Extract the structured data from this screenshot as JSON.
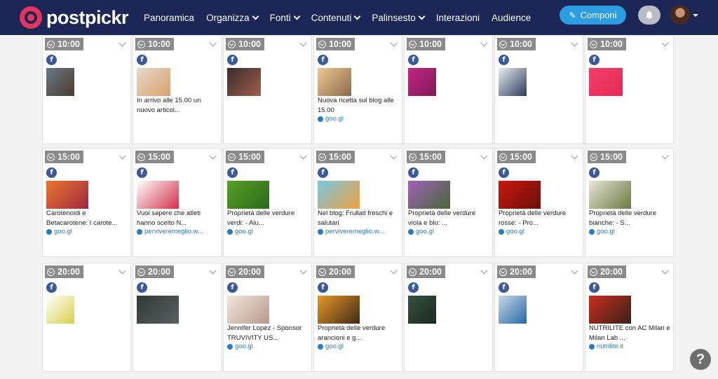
{
  "brand": {
    "name": "postpickr"
  },
  "nav": {
    "items": [
      {
        "label": "Panoramica",
        "dropdown": false
      },
      {
        "label": "Organizza",
        "dropdown": true
      },
      {
        "label": "Fonti",
        "dropdown": true
      },
      {
        "label": "Contenuti",
        "dropdown": true
      },
      {
        "label": "Palinsesto",
        "dropdown": true
      },
      {
        "label": "Interazioni",
        "dropdown": false
      },
      {
        "label": "Audience",
        "dropdown": false
      }
    ],
    "compose_label": "Componi"
  },
  "help_label": "?",
  "posts": [
    {
      "time": "10:00",
      "network": "f",
      "text": "",
      "link": "",
      "thumb": [
        "#6a7a88",
        "#4a3a2a"
      ]
    },
    {
      "time": "10:00",
      "network": "f",
      "text": "In arrivo alle 15.00 un nuovo articol...",
      "link": "",
      "thumb": [
        "#e8d8c8",
        "#d8a070"
      ]
    },
    {
      "time": "10:00",
      "network": "f",
      "text": "",
      "link": "",
      "thumb": [
        "#3a2a28",
        "#a06050"
      ]
    },
    {
      "time": "10:00",
      "network": "f",
      "text": "Nuova ricetta sul blog alle 15.00",
      "link": "goo.gl",
      "thumb": [
        "#f0c890",
        "#8a6a50"
      ]
    },
    {
      "time": "10:00",
      "network": "f",
      "text": "",
      "link": "",
      "thumb": [
        "#c02880",
        "#801858"
      ]
    },
    {
      "time": "10:00",
      "network": "f",
      "text": "",
      "link": "",
      "thumb": [
        "#e8eef4",
        "#2a3a5a"
      ]
    },
    {
      "time": "10:00",
      "network": "f",
      "text": "",
      "link": "",
      "thumb": [
        "#f04068",
        "#e82858"
      ]
    },
    {
      "time": "15:00",
      "network": "f",
      "text": "Carotenoidi e Betacarotene: I carote...",
      "link": "goo.gl",
      "thumb": [
        "#e87830",
        "#a02840"
      ]
    },
    {
      "time": "15:00",
      "network": "f",
      "text": "Vuoi sapere che atleti hanno scelto N...",
      "link": "perviveremeglio.w...",
      "thumb": [
        "#ffffff",
        "#d03048"
      ]
    },
    {
      "time": "15:00",
      "network": "f",
      "text": "Proprietà delle verdure verdi: - Aiu...",
      "link": "goo.gl",
      "thumb": [
        "#58a028",
        "#2a6a18"
      ]
    },
    {
      "time": "15:00",
      "network": "f",
      "text": "Nel blog: Frullati freschi e salutari",
      "link": "perviveremeglio.w...",
      "thumb": [
        "#78c8e0",
        "#f0a040"
      ]
    },
    {
      "time": "15:00",
      "network": "f",
      "text": "Proprietà delle verdure viola e blu: ...",
      "link": "goo.gl",
      "thumb": [
        "#a060b8",
        "#486838"
      ]
    },
    {
      "time": "15:00",
      "network": "f",
      "text": "Proprietà delle verdure rosse: - Pro...",
      "link": "goo.gl",
      "thumb": [
        "#c81810",
        "#6a1008"
      ]
    },
    {
      "time": "15:00",
      "network": "f",
      "text": "Proprietà delle verdure bianche: - S...",
      "link": "goo.gl",
      "thumb": [
        "#e8e4d8",
        "#6a7a40"
      ]
    },
    {
      "time": "20:00",
      "network": "f",
      "text": "",
      "link": "",
      "thumb": [
        "#ffffff",
        "#d8d048"
      ]
    },
    {
      "time": "20:00",
      "network": "f",
      "text": "",
      "link": "",
      "thumb": [
        "#303838",
        "#586060"
      ]
    },
    {
      "time": "20:00",
      "network": "f",
      "text": "Jennifer Lopez - Sponsor TRUVIVITY US...",
      "link": "goo.gl",
      "thumb": [
        "#f0e8e0",
        "#b89888"
      ]
    },
    {
      "time": "20:00",
      "network": "f",
      "text": "Proprietà delle verdure arancioni e g...",
      "link": "goo.gl",
      "thumb": [
        "#e89828",
        "#402818"
      ]
    },
    {
      "time": "20:00",
      "network": "f",
      "text": "",
      "link": "",
      "thumb": [
        "#385040",
        "#1a2a20"
      ]
    },
    {
      "time": "20:00",
      "network": "f",
      "text": "",
      "link": "",
      "thumb": [
        "#c8d8e8",
        "#2868a8"
      ]
    },
    {
      "time": "20:00",
      "network": "f",
      "text": "NUTRILITE con AC Milan e Milan Lab ...",
      "link": "nutrilite.it",
      "thumb": [
        "#c83020",
        "#382018"
      ]
    }
  ]
}
